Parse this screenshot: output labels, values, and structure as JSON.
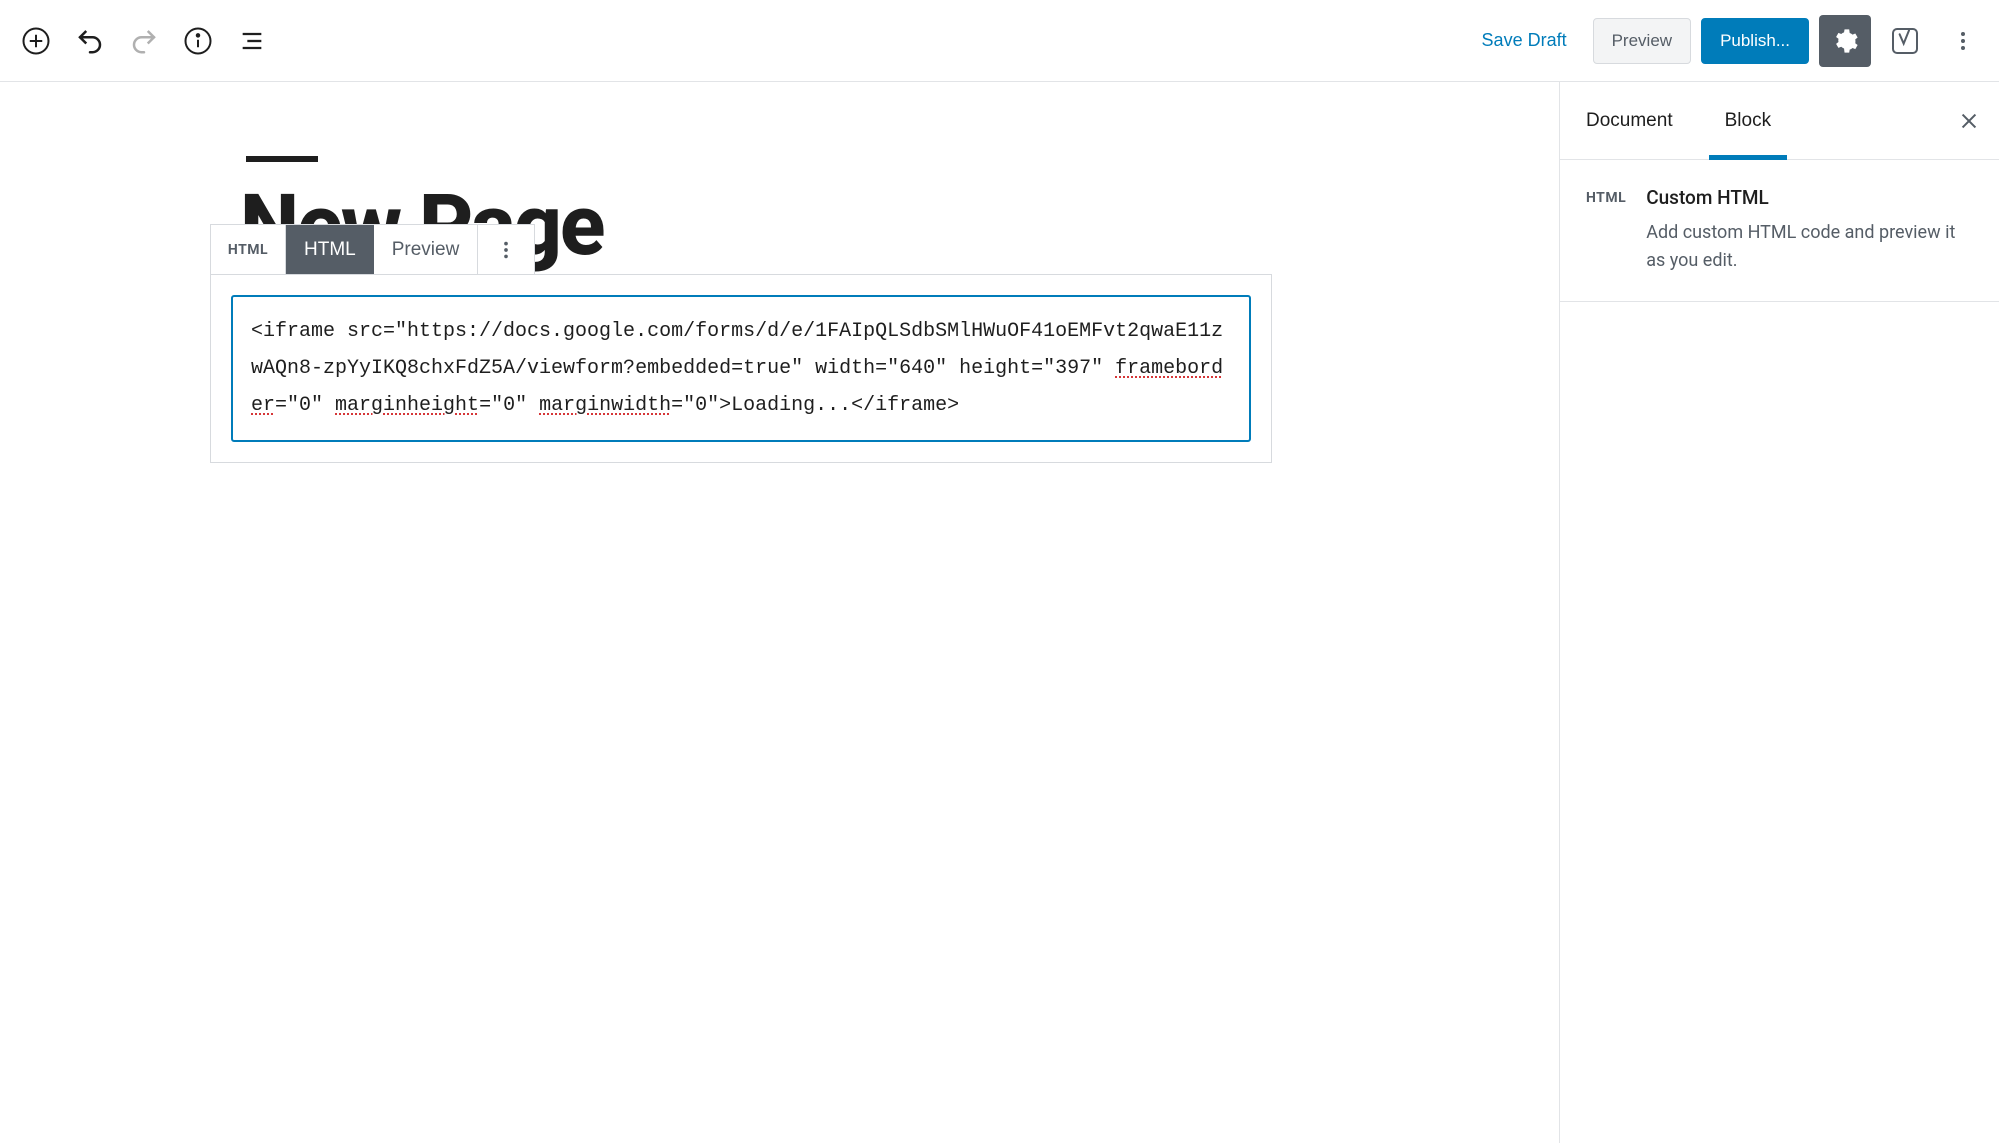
{
  "toolbar": {
    "save_draft": "Save Draft",
    "preview": "Preview",
    "publish": "Publish..."
  },
  "page": {
    "title": "New Page"
  },
  "block_toolbar": {
    "icon_label": "HTML",
    "tab_html": "HTML",
    "tab_preview": "Preview"
  },
  "block_content": {
    "code_line1": "<iframe src=\"https://docs.google.com/forms/d/e/1FAIpQLSdbSMlHWuOF41oEMFvt2qwaE11zwAQn8-zpYyIKQ8chxFdZ5A/viewform?embedded=true\" width=\"640\" height=\"397\" ",
    "attr_frameborder": "frameborder",
    "eq0a": "=\"0\" ",
    "attr_marginheight": "marginheight",
    "eq0b": "=\"0\" ",
    "attr_marginwidth": "marginwidth",
    "tail": "=\"0\">Loading...</iframe>"
  },
  "sidebar": {
    "tab_document": "Document",
    "tab_block": "Block",
    "block_icon": "HTML",
    "block_title": "Custom HTML",
    "block_desc": "Add custom HTML code and preview it as you edit."
  }
}
